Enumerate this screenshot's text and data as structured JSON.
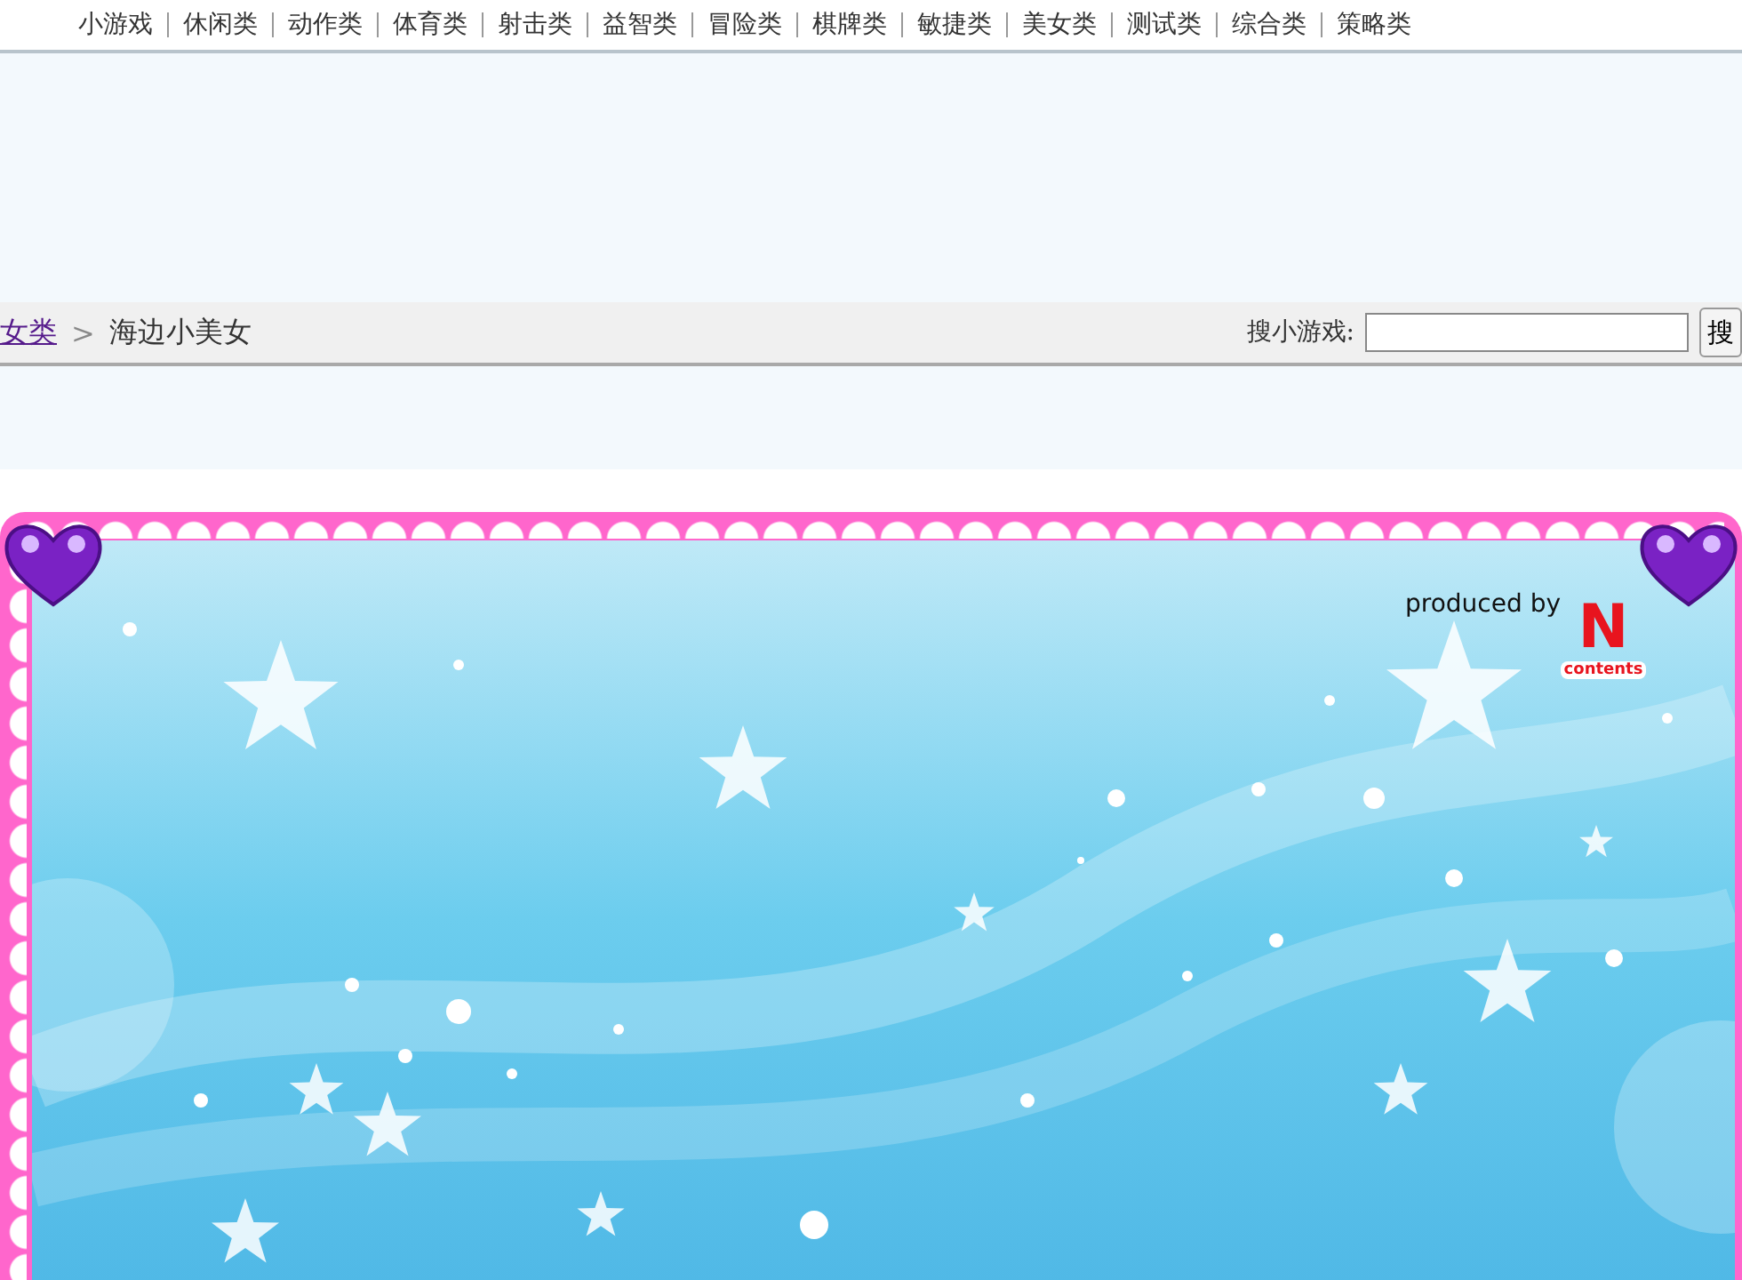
{
  "nav": {
    "items": [
      "小游戏",
      "休闲类",
      "动作类",
      "体育类",
      "射击类",
      "益智类",
      "冒险类",
      "棋牌类",
      "敏捷类",
      "美女类",
      "测试类",
      "综合类",
      "策略类"
    ]
  },
  "breadcrumb": {
    "link": "女类",
    "separator": ">",
    "current": "海边小美女"
  },
  "search": {
    "label": "搜小游戏:",
    "button": "搜"
  },
  "game": {
    "credit": "produced by",
    "logo_letter": "N",
    "logo_caption": "contents"
  }
}
